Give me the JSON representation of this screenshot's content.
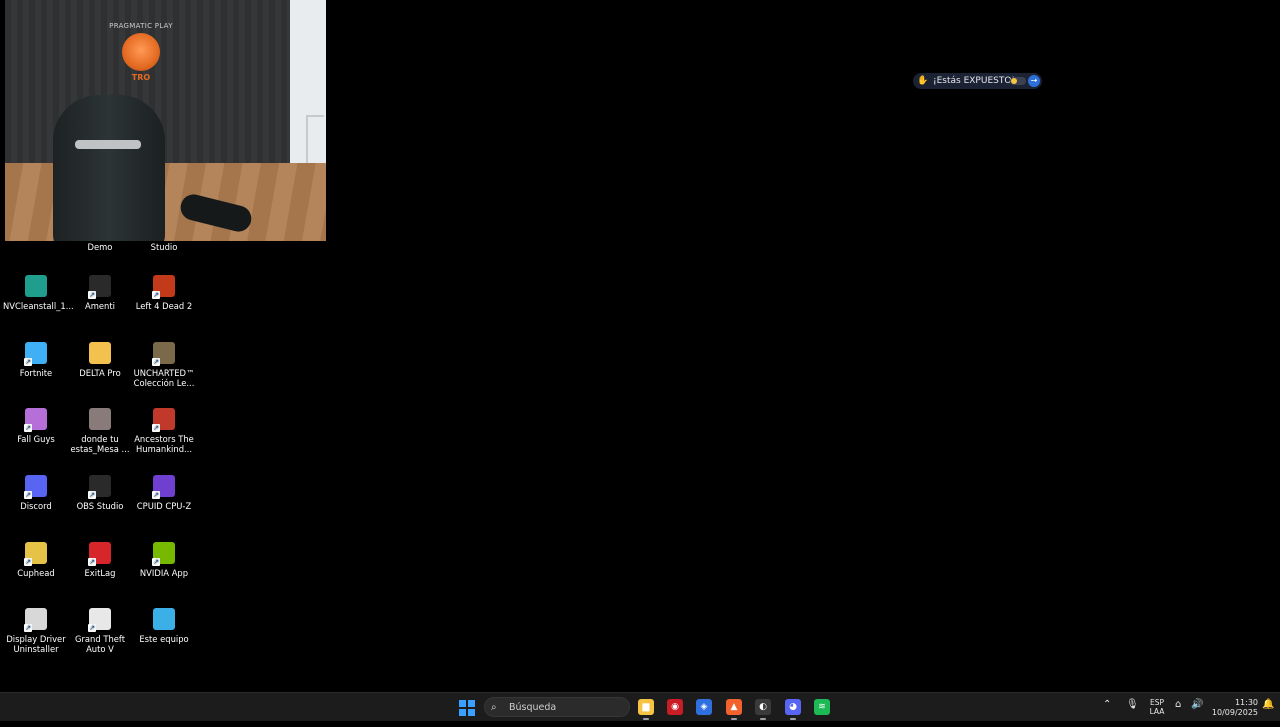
{
  "exposure_pill": {
    "text": "¡Estás EXPUESTO!"
  },
  "webcam": {
    "brand": "PRAGMATIC PLAY",
    "sub": "TRO"
  },
  "desktop_icons": [
    {
      "label": "Demo",
      "color": "",
      "shortcut": false
    },
    {
      "label": "Studio",
      "color": "",
      "shortcut": false
    },
    {
      "label": "NVCleanstall_1...",
      "color": "#1f9e8e",
      "shortcut": false
    },
    {
      "label": "Amenti",
      "color": "#2a2a2a",
      "shortcut": true
    },
    {
      "label": "Left 4 Dead 2",
      "color": "#c23a1a",
      "shortcut": true
    },
    {
      "label": "Fortnite",
      "color": "#3fb0f5",
      "shortcut": true
    },
    {
      "label": "DELTA Pro",
      "color": "#f2c14e",
      "shortcut": false
    },
    {
      "label": "UNCHARTED™ Colección Le...",
      "color": "#7a6a4a",
      "shortcut": true
    },
    {
      "label": "Fall Guys",
      "color": "#b66fd9",
      "shortcut": true
    },
    {
      "label": "donde tu estas_Mesa ...",
      "color": "#8a7b7b",
      "shortcut": false
    },
    {
      "label": "Ancestors The Humankind...",
      "color": "#c0392b",
      "shortcut": true
    },
    {
      "label": "Discord",
      "color": "#5865f2",
      "shortcut": true
    },
    {
      "label": "OBS Studio",
      "color": "#2a2a2a",
      "shortcut": true
    },
    {
      "label": "CPUID CPU-Z",
      "color": "#6f3fcf",
      "shortcut": true
    },
    {
      "label": "Cuphead",
      "color": "#e6c347",
      "shortcut": true
    },
    {
      "label": "ExitLag",
      "color": "#d7262a",
      "shortcut": true
    },
    {
      "label": "NVIDIA App",
      "color": "#76b900",
      "shortcut": true
    },
    {
      "label": "Display Driver Uninstaller",
      "color": "#d8d8d8",
      "shortcut": true
    },
    {
      "label": "Grand Theft Auto V",
      "color": "#e8e8e8",
      "shortcut": true
    },
    {
      "label": "Este equipo",
      "color": "#3ab0e6",
      "shortcut": false
    }
  ],
  "taskbar": {
    "search_placeholder": "Búsqueda",
    "apps": [
      {
        "name": "file-explorer",
        "color": "#f6c343",
        "glyph": "▆"
      },
      {
        "name": "app-red-shield",
        "color": "#c81d25",
        "glyph": "◉"
      },
      {
        "name": "app-blue-shield",
        "color": "#2f6fe0",
        "glyph": "◈"
      },
      {
        "name": "brave-browser",
        "color": "#f2622d",
        "glyph": "▲"
      },
      {
        "name": "obs-studio",
        "color": "#3a3a3a",
        "glyph": "◐"
      },
      {
        "name": "discord",
        "color": "#5865f2",
        "glyph": "◕"
      },
      {
        "name": "spotify",
        "color": "#1db954",
        "glyph": "≋"
      }
    ],
    "lang_top": "ESP",
    "lang_bottom": "LAA",
    "time": "11:30",
    "date": "10/09/2025"
  }
}
